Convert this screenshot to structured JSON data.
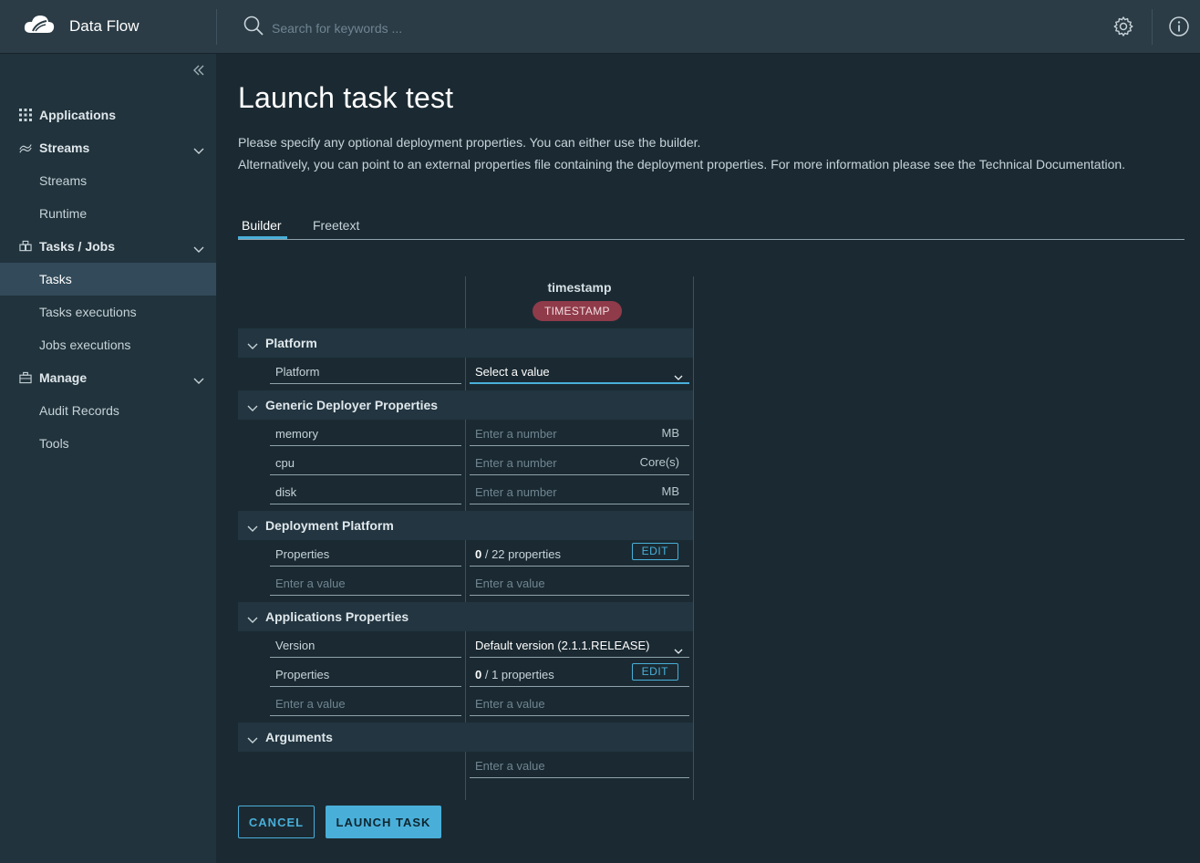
{
  "header": {
    "app_title": "Data Flow",
    "search_placeholder": "Search for keywords ..."
  },
  "sidebar": {
    "groups": [
      {
        "label": "Applications",
        "icon": "grid-icon"
      },
      {
        "label": "Streams",
        "icon": "streams-icon",
        "items": [
          "Streams",
          "Runtime"
        ]
      },
      {
        "label": "Tasks / Jobs",
        "icon": "tasks-icon",
        "items": [
          "Tasks",
          "Tasks executions",
          "Jobs executions"
        ]
      },
      {
        "label": "Manage",
        "icon": "briefcase-icon",
        "items": [
          "Audit Records",
          "Tools"
        ]
      }
    ],
    "active_item": "Tasks"
  },
  "page": {
    "title": "Launch task test",
    "desc_line1": "Please specify any optional deployment properties. You can either use the builder.",
    "desc_line2": "Alternatively, you can point to an external properties file containing the deployment properties. For more information please see the Technical Documentation.",
    "tabs": [
      "Builder",
      "Freetext"
    ],
    "active_tab": "Builder"
  },
  "builder": {
    "app_name": "timestamp",
    "app_badge": "TIMESTAMP",
    "sections": {
      "platform": {
        "label": "Platform",
        "key": "Platform",
        "value": "Select a value"
      },
      "generic": {
        "label": "Generic Deployer Properties",
        "rows": [
          {
            "key": "memory",
            "placeholder": "Enter a number",
            "unit": "MB"
          },
          {
            "key": "cpu",
            "placeholder": "Enter a number",
            "unit": "Core(s)"
          },
          {
            "key": "disk",
            "placeholder": "Enter a number",
            "unit": "MB"
          }
        ]
      },
      "deployment": {
        "label": "Deployment Platform",
        "key": "Properties",
        "count": "0",
        "count_text": " / 22 properties",
        "edit": "EDIT",
        "key_placeholder": "Enter a value",
        "value_placeholder": "Enter a value"
      },
      "applications": {
        "label": "Applications Properties",
        "version_key": "Version",
        "version_value": "Default version (2.1.1.RELEASE)",
        "props_key": "Properties",
        "count": "0",
        "count_text": " / 1 properties",
        "edit": "EDIT",
        "key_placeholder": "Enter a value",
        "value_placeholder": "Enter a value"
      },
      "arguments": {
        "label": "Arguments",
        "value_placeholder": "Enter a value"
      }
    }
  },
  "footer": {
    "cancel": "CANCEL",
    "launch": "LAUNCH TASK"
  },
  "colors": {
    "accent": "#49afd9",
    "badge": "#8f3b4a",
    "active_nav": "#324a59"
  }
}
